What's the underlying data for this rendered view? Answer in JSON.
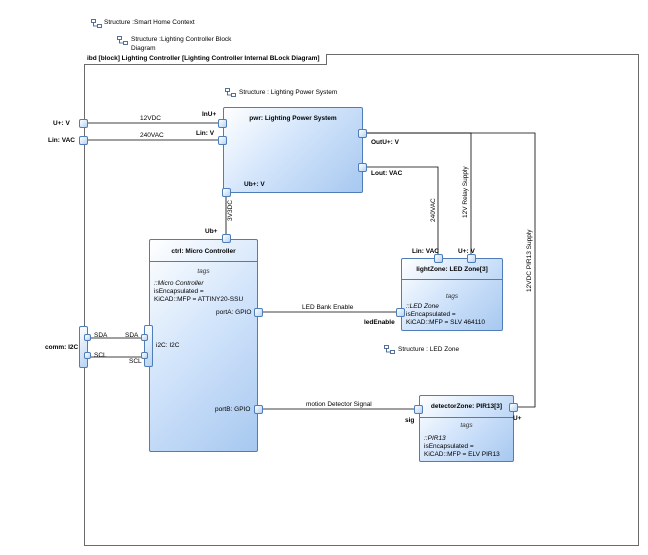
{
  "header": {
    "context_structure": "Structure :Smart Home Context",
    "diagram_structure_line1": "Structure :Lighting Controller Block",
    "diagram_structure_line2": "Diagram"
  },
  "frame": {
    "title": "ibd [block] Lighting Controller [Lighting Controller Internal BLock Diagram]"
  },
  "boundary_ports": {
    "u_plus": "U+: V",
    "lin": "Lin: VAC",
    "comm": "comm: I2C",
    "sda": "SDA",
    "scl": "SCL"
  },
  "power_system": {
    "structure_label": "Structure : Lighting Power System",
    "title": "pwr: Lighting Power System",
    "port_inu": "InU+",
    "port_lin": "Lin: V",
    "port_outu": "OutU+: V",
    "port_lout": "Lout: VAC",
    "port_ub": "Ub+: V"
  },
  "micro_controller": {
    "title": "ctrl: Micro Controller",
    "tags_header": "tags",
    "tag_type": "::Micro Controller",
    "tag_encapsulated": "isEncapsulated =",
    "tag_mfp": "KiCAD::MFP = ATTINY20-SSU",
    "port_ub": "Ub+",
    "port_a": "portA: GPIO",
    "port_b": "portB: GPIO",
    "port_i2c": "i2C: I2C",
    "sda": "SDA",
    "scl": "SCL"
  },
  "light_zone": {
    "title": "lightZone: LED Zone[3]",
    "tags_header": "tags",
    "tag_type": "::LED Zone",
    "tag_encapsulated": "isEncapsulated =",
    "tag_mfp": "KiCAD::MFP = SLV 464110",
    "port_lin": "Lin: VAC",
    "port_u": "U+: V",
    "port_led_enable": "ledEnable",
    "structure_label": "Structure : LED Zone"
  },
  "detector_zone": {
    "title": "detectorZone: PIR13[3]",
    "tags_header": "tags",
    "tag_type": "::PIR13",
    "tag_encapsulated": "isEncapsulated =",
    "tag_mfp": "KiCAD::MFP = ELV PIR13",
    "port_sig": "sig",
    "port_u": "U+"
  },
  "connectors": {
    "v12dc": "12VDC",
    "vac240": "240VAC",
    "v3dc": "3V3DC",
    "vac240_vertical": "240VAC",
    "relay_supply": "12V Relay Supply",
    "pir13_supply": "12VDC PIR13 Supply",
    "led_bank_enable": "LED Bank Enable",
    "motion_signal": "motion Detector Signal"
  },
  "colors": {
    "block_border": "#4f7db7",
    "block_fill": "#a7c8f0",
    "line": "#000000"
  }
}
